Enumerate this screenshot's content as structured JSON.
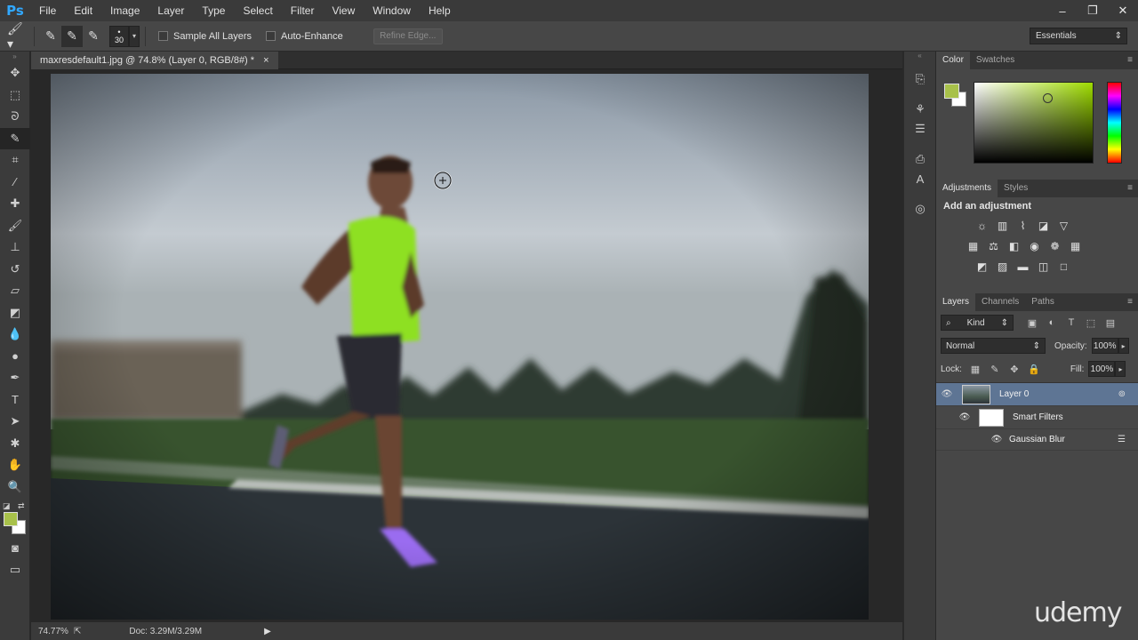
{
  "app": {
    "logo": "Ps"
  },
  "menu": [
    "File",
    "Edit",
    "Image",
    "Layer",
    "Type",
    "Select",
    "Filter",
    "View",
    "Window",
    "Help"
  ],
  "window_controls": {
    "minimize": "–",
    "restore": "❐",
    "close": "✕"
  },
  "options": {
    "brush_size": "30",
    "sample_all_layers": "Sample All Layers",
    "auto_enhance": "Auto-Enhance",
    "refine_edge": "Refine Edge...",
    "workspace": "Essentials"
  },
  "document": {
    "tab_title": "maxresdefault1.jpg @ 74.8% (Layer 0, RGB/8#) *",
    "tab_close": "×"
  },
  "status": {
    "zoom": "74.77%",
    "doc_size": "Doc: 3.29M/3.29M"
  },
  "colors": {
    "foreground": "#a8c14a",
    "background": "#ffffff"
  },
  "color_panel": {
    "tabs": [
      "Color",
      "Swatches"
    ]
  },
  "adjustments_panel": {
    "tabs": [
      "Adjustments",
      "Styles"
    ],
    "title": "Add an adjustment"
  },
  "layers_panel": {
    "tabs": [
      "Layers",
      "Channels",
      "Paths"
    ],
    "filter_kind": "Kind",
    "blend_mode": "Normal",
    "opacity_label": "Opacity:",
    "opacity_value": "100%",
    "lock_label": "Lock:",
    "fill_label": "Fill:",
    "fill_value": "100%",
    "layers": [
      {
        "name": "Layer 0"
      },
      {
        "name": "Smart Filters"
      },
      {
        "name": "Gaussian Blur"
      }
    ]
  },
  "watermark": "udemy"
}
